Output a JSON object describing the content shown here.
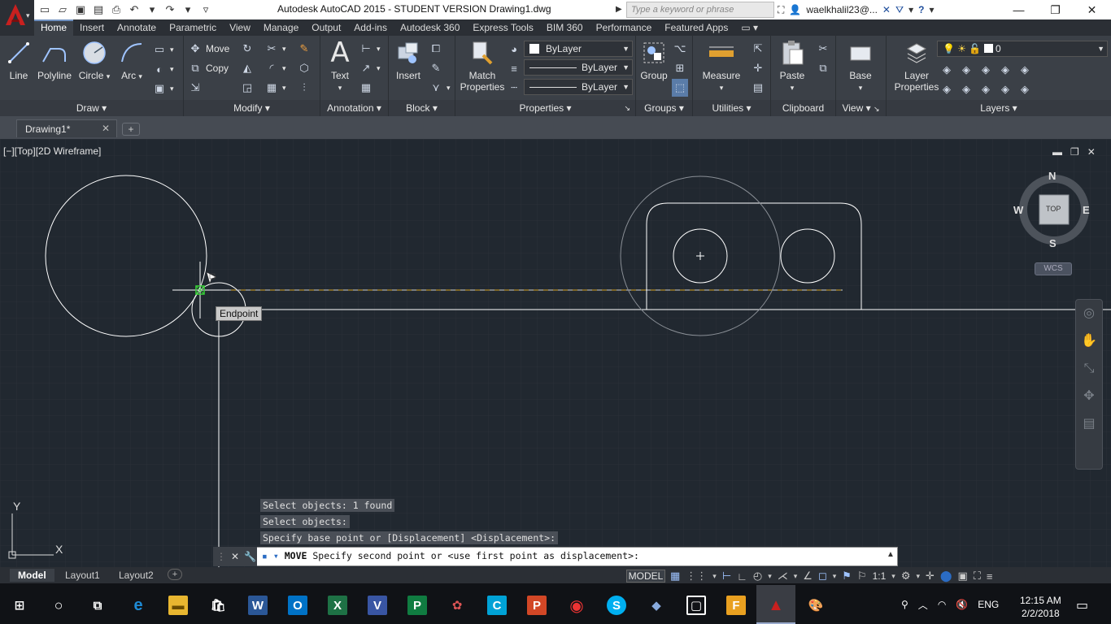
{
  "title_bar": {
    "title": "Autodesk AutoCAD 2015 - STUDENT VERSION    Drawing1.dwg",
    "search_placeholder": "Type a keyword or phrase",
    "user": "waelkhalil23@..."
  },
  "ribbon_tabs": [
    "Home",
    "Insert",
    "Annotate",
    "Parametric",
    "View",
    "Manage",
    "Output",
    "Add-ins",
    "Autodesk 360",
    "Express Tools",
    "BIM 360",
    "Performance",
    "Featured Apps"
  ],
  "panels": {
    "draw": {
      "title": "Draw",
      "line": "Line",
      "polyline": "Polyline",
      "circle": "Circle",
      "arc": "Arc"
    },
    "modify": {
      "title": "Modify",
      "move": "Move",
      "copy": "Copy"
    },
    "annotation": {
      "title": "Annotation",
      "text": "Text"
    },
    "block": {
      "title": "Block",
      "insert": "Insert"
    },
    "properties": {
      "title": "Properties",
      "match_line1": "Match",
      "match_line2": "Properties",
      "color": "ByLayer",
      "linetype": "ByLayer",
      "lineweight": "ByLayer"
    },
    "groups": {
      "title": "Groups",
      "group": "Group"
    },
    "utilities": {
      "title": "Utilities",
      "measure": "Measure"
    },
    "clipboard": {
      "title": "Clipboard",
      "paste": "Paste"
    },
    "view": {
      "title": "View",
      "base": "Base"
    },
    "layers": {
      "title": "Layers",
      "layer_line1": "Layer",
      "layer_line2": "Properties",
      "current_layer": "0"
    }
  },
  "doc_tab": {
    "name": "Drawing1*"
  },
  "viewport": {
    "label": "[−][Top][2D Wireframe]"
  },
  "tooltip": {
    "text": "Endpoint"
  },
  "viewcube": {
    "n": "N",
    "s": "S",
    "e": "E",
    "w": "W",
    "top": "TOP",
    "wcs": "WCS"
  },
  "ucs": {
    "x": "X",
    "y": "Y"
  },
  "command": {
    "history": [
      "Select objects: 1 found",
      "Select objects:",
      "Specify base point or [Displacement] <Displacement>:"
    ],
    "current_cmd": "MOVE",
    "current_prompt": "Specify second point or <use first point as displacement>:"
  },
  "layout_tabs": [
    "Model",
    "Layout1",
    "Layout2"
  ],
  "status": {
    "model": "MODEL",
    "scale": "1:1"
  },
  "taskbar": {
    "lang": "ENG",
    "time": "12:15 AM",
    "date": "2/2/2018"
  },
  "colors": {
    "accent_blue": "#2b6cc4",
    "autocad_red": "#c8201f",
    "canvas": "#212830"
  }
}
